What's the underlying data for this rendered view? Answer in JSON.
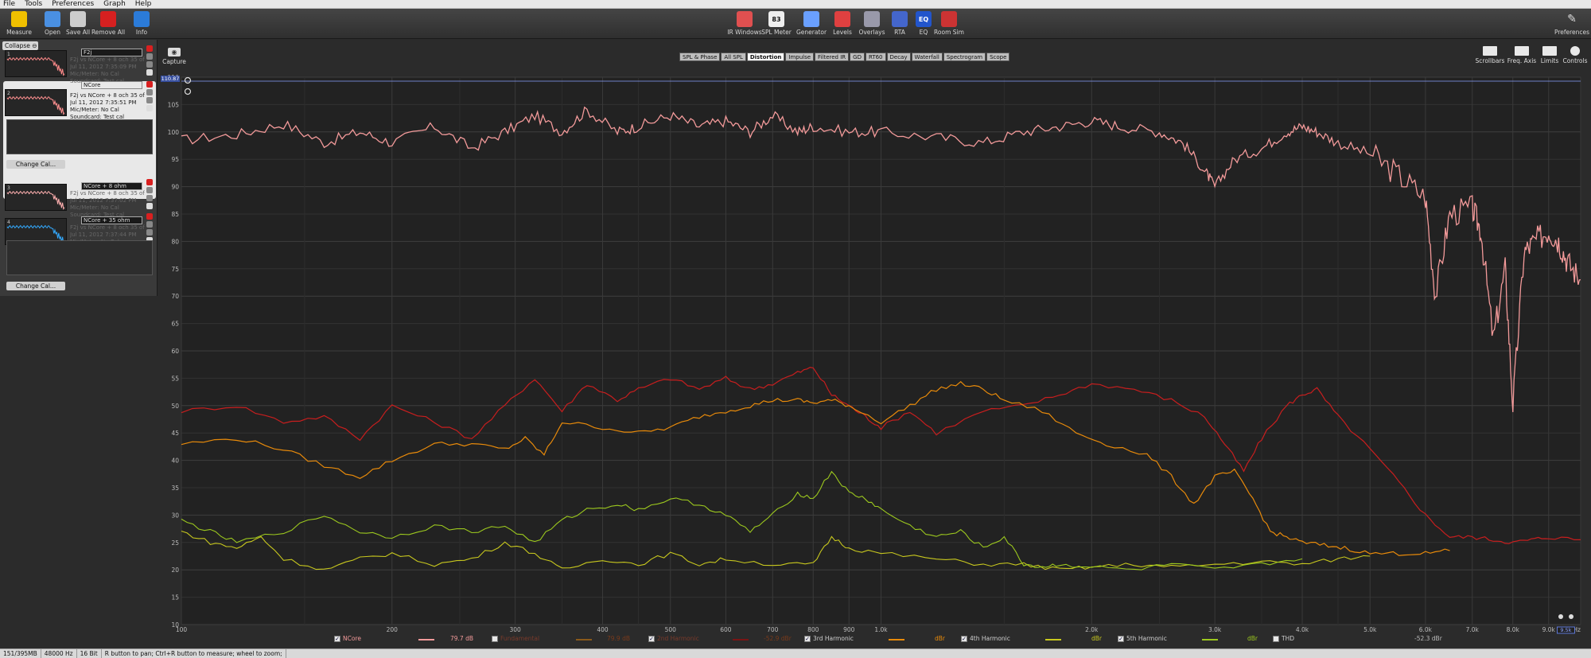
{
  "menu": [
    "File",
    "Tools",
    "Preferences",
    "Graph",
    "Help"
  ],
  "toolbar_left": [
    {
      "label": "Measure",
      "icon": "measure-icon",
      "color": "#f0c000"
    },
    {
      "label": "Open",
      "icon": "folder-icon",
      "color": "#4a90e2"
    },
    {
      "label": "Save All",
      "icon": "save-icon",
      "color": "#cccccc"
    },
    {
      "label": "Remove All",
      "icon": "remove-icon",
      "color": "#d62020"
    },
    {
      "label": "Info",
      "icon": "info-icon",
      "color": "#2b7bd9"
    }
  ],
  "toolbar_center": [
    {
      "label": "IR Windows",
      "icon": "ir-windows-icon",
      "color": "#e05050"
    },
    {
      "label": "SPL Meter",
      "icon": "spl-meter-icon",
      "color": "#eeeeee",
      "glyph": "83"
    },
    {
      "label": "Generator",
      "icon": "generator-icon",
      "color": "#6aa0ff"
    },
    {
      "label": "Levels",
      "icon": "levels-icon",
      "color": "#e04040"
    },
    {
      "label": "Overlays",
      "icon": "overlays-icon",
      "color": "#9999aa"
    },
    {
      "label": "RTA",
      "icon": "rta-icon",
      "color": "#4466cc"
    },
    {
      "label": "EQ",
      "icon": "eq-icon",
      "color": "#2255cc",
      "glyph": "EQ"
    },
    {
      "label": "Room Sim",
      "icon": "room-sim-icon",
      "color": "#cc3333"
    }
  ],
  "preferences_label": "Preferences",
  "collapse_label": "Collapse",
  "measurements": [
    {
      "name": "F2j",
      "info": [
        "F2j vs NCore + 8 och 35 of",
        "Jul 11, 2012 7:35:09 PM",
        "Mic/Meter: No Cal",
        "Soundcard: Test cal"
      ],
      "num": "1",
      "color": "#ff8a8a",
      "selected": false
    },
    {
      "name": "NCore",
      "info": [
        "F2j vs NCore + 8 och 35 of",
        "Jul 11, 2012 7:35:51 PM",
        "Mic/Meter: No Cal",
        "Soundcard: Test cal"
      ],
      "num": "2",
      "color": "#ff9090",
      "selected": true
    },
    {
      "name": "NCore + 8 ohm",
      "info": [
        "F2j vs NCore + 8 och 35 of",
        "Jul 11, 2012 7:37:02 PM",
        "Mic/Meter: No Cal",
        "Soundcard: Test cal"
      ],
      "num": "3",
      "color": "#ffb0b0",
      "selected": false
    },
    {
      "name": "NCore + 35 ohm",
      "info": [
        "F2j vs NCore + 8 och 35 of",
        "Jul 11, 2012 7:37:44 PM",
        "Mic/Meter: No Cal",
        "Soundcard: Test cal"
      ],
      "num": "4",
      "color": "#33aaff",
      "selected": false
    }
  ],
  "change_cal_label": "Change Cal...",
  "capture_label": "Capture",
  "tabs": [
    "SPL & Phase",
    "All SPL",
    "Distortion",
    "Impulse",
    "Filtered IR",
    "GD",
    "RT60",
    "Decay",
    "Waterfall",
    "Spectrogram",
    "Scope"
  ],
  "active_tab": "Distortion",
  "right_buttons": [
    "Scrollbars",
    "Freq. Axis",
    "Limits",
    "Controls"
  ],
  "top_readout": "110.87",
  "chart_data": {
    "type": "line",
    "x_scale": "log",
    "xlim": [
      100,
      10000
    ],
    "ylim": [
      10,
      110
    ],
    "y_ticks": [
      10,
      15,
      20,
      25,
      30,
      35,
      40,
      45,
      50,
      55,
      60,
      65,
      70,
      75,
      80,
      85,
      90,
      95,
      100,
      105,
      110
    ],
    "y_tick_labels": [
      "10",
      "15",
      "20",
      "25",
      "30",
      "35",
      "40",
      "45",
      "50",
      "55",
      "60",
      "65",
      "70",
      "75",
      "80",
      "85",
      "90",
      "95",
      "100",
      "105",
      "110"
    ],
    "x_ticks": [
      100,
      200,
      300,
      400,
      500,
      600,
      700,
      800,
      900,
      1000,
      2000,
      3000,
      4000,
      5000,
      6000,
      7000,
      8000,
      9000,
      10000
    ],
    "x_tick_labels": [
      "100",
      "200",
      "300",
      "400",
      "500",
      "600",
      "700",
      "800",
      "900",
      "1.0k",
      "2.0k",
      "3.0k",
      "4.0k",
      "5.0k",
      "6.0k",
      "7.0k",
      "8.0k",
      "9.0k",
      "10k Hz"
    ],
    "x_readout": "9.5k",
    "grid": true,
    "series": [
      {
        "name": "NCore",
        "color": "#f39a9a",
        "width": 1.3,
        "points": [
          [
            100,
            98.5
          ],
          [
            120,
            99.5
          ],
          [
            140,
            101.5
          ],
          [
            160,
            98
          ],
          [
            180,
            100
          ],
          [
            200,
            98
          ],
          [
            230,
            101
          ],
          [
            260,
            97
          ],
          [
            290,
            100
          ],
          [
            320,
            103
          ],
          [
            350,
            100
          ],
          [
            380,
            104
          ],
          [
            420,
            100
          ],
          [
            450,
            101
          ],
          [
            500,
            103
          ],
          [
            550,
            101
          ],
          [
            600,
            102
          ],
          [
            650,
            100
          ],
          [
            700,
            103
          ],
          [
            760,
            100
          ],
          [
            800,
            101
          ],
          [
            900,
            100
          ],
          [
            1000,
            100
          ],
          [
            1200,
            99
          ],
          [
            1400,
            98
          ],
          [
            1600,
            100
          ],
          [
            1800,
            101
          ],
          [
            2000,
            102
          ],
          [
            2200,
            101
          ],
          [
            2500,
            100
          ],
          [
            2700,
            98
          ],
          [
            2900,
            93
          ],
          [
            3000,
            90
          ],
          [
            3200,
            95
          ],
          [
            3500,
            97
          ],
          [
            3800,
            100
          ],
          [
            4000,
            101
          ],
          [
            4200,
            100
          ],
          [
            4500,
            98
          ],
          [
            5000,
            96
          ],
          [
            5500,
            92
          ],
          [
            6000,
            88
          ],
          [
            6200,
            70
          ],
          [
            6500,
            85
          ],
          [
            7000,
            86
          ],
          [
            7200,
            82
          ],
          [
            7500,
            62
          ],
          [
            7800,
            75
          ],
          [
            8000,
            50
          ],
          [
            8300,
            78
          ],
          [
            8600,
            80
          ],
          [
            9000,
            82
          ],
          [
            9300,
            80
          ],
          [
            9600,
            76
          ],
          [
            10000,
            73
          ]
        ]
      },
      {
        "name": "2nd Harmonic",
        "color": "#c81e1e",
        "width": 1.2,
        "points": [
          [
            100,
            49
          ],
          [
            120,
            50
          ],
          [
            140,
            47
          ],
          [
            160,
            48
          ],
          [
            180,
            44
          ],
          [
            200,
            50
          ],
          [
            230,
            47
          ],
          [
            260,
            44
          ],
          [
            290,
            50
          ],
          [
            320,
            55
          ],
          [
            350,
            49
          ],
          [
            380,
            54
          ],
          [
            420,
            51
          ],
          [
            450,
            53
          ],
          [
            500,
            55
          ],
          [
            550,
            53
          ],
          [
            600,
            55
          ],
          [
            650,
            53
          ],
          [
            700,
            54
          ],
          [
            760,
            56
          ],
          [
            800,
            57
          ],
          [
            850,
            52
          ],
          [
            900,
            50
          ],
          [
            950,
            48
          ],
          [
            1000,
            46
          ],
          [
            1100,
            49
          ],
          [
            1200,
            45
          ],
          [
            1400,
            49
          ],
          [
            1600,
            50
          ],
          [
            1800,
            52
          ],
          [
            2000,
            54
          ],
          [
            2300,
            53
          ],
          [
            2600,
            51
          ],
          [
            2900,
            48
          ],
          [
            3100,
            43
          ],
          [
            3300,
            38
          ],
          [
            3500,
            44
          ],
          [
            3800,
            50
          ],
          [
            4000,
            52
          ],
          [
            4200,
            53
          ],
          [
            4500,
            48
          ],
          [
            5000,
            42
          ],
          [
            5500,
            36
          ],
          [
            6000,
            30
          ],
          [
            6500,
            26
          ],
          [
            7000,
            26
          ],
          [
            7500,
            25.5
          ],
          [
            8000,
            25
          ],
          [
            8500,
            25.5
          ],
          [
            9000,
            26
          ],
          [
            10000,
            25.5
          ]
        ]
      },
      {
        "name": "3rd Harmonic",
        "color": "#e88a0a",
        "width": 1.2,
        "points": [
          [
            100,
            43
          ],
          [
            120,
            44
          ],
          [
            140,
            42
          ],
          [
            160,
            39
          ],
          [
            180,
            37
          ],
          [
            200,
            40
          ],
          [
            230,
            43
          ],
          [
            260,
            43
          ],
          [
            290,
            42
          ],
          [
            310,
            44
          ],
          [
            330,
            41
          ],
          [
            350,
            47
          ],
          [
            400,
            46
          ],
          [
            450,
            45
          ],
          [
            500,
            46
          ],
          [
            550,
            48
          ],
          [
            600,
            49
          ],
          [
            650,
            50
          ],
          [
            700,
            51
          ],
          [
            760,
            51
          ],
          [
            800,
            50.5
          ],
          [
            850,
            51
          ],
          [
            900,
            50
          ],
          [
            1000,
            47
          ],
          [
            1100,
            50
          ],
          [
            1200,
            53
          ],
          [
            1300,
            54
          ],
          [
            1400,
            53
          ],
          [
            1500,
            51
          ],
          [
            1700,
            49
          ],
          [
            1900,
            45
          ],
          [
            2100,
            43
          ],
          [
            2400,
            41
          ],
          [
            2600,
            37
          ],
          [
            2800,
            32
          ],
          [
            3000,
            37
          ],
          [
            3200,
            38
          ],
          [
            3400,
            33
          ],
          [
            3600,
            27
          ],
          [
            3800,
            26
          ],
          [
            4000,
            25
          ],
          [
            4300,
            24.5
          ],
          [
            4600,
            24
          ],
          [
            5000,
            23
          ],
          [
            5500,
            23
          ],
          [
            6000,
            23
          ],
          [
            6500,
            23.5
          ]
        ]
      },
      {
        "name": "4th Harmonic",
        "color": "#c8c81e",
        "width": 1.1,
        "points": [
          [
            100,
            27
          ],
          [
            110,
            25
          ],
          [
            120,
            24
          ],
          [
            130,
            26
          ],
          [
            140,
            22
          ],
          [
            160,
            20
          ],
          [
            180,
            22
          ],
          [
            200,
            23
          ],
          [
            230,
            21
          ],
          [
            260,
            22
          ],
          [
            290,
            25
          ],
          [
            320,
            23
          ],
          [
            350,
            20
          ],
          [
            400,
            22
          ],
          [
            450,
            21
          ],
          [
            500,
            23
          ],
          [
            550,
            21
          ],
          [
            600,
            22
          ],
          [
            700,
            21
          ],
          [
            800,
            21
          ],
          [
            850,
            26
          ],
          [
            900,
            24
          ],
          [
            1000,
            23
          ],
          [
            1200,
            22
          ],
          [
            1400,
            21
          ],
          [
            1600,
            21
          ],
          [
            1800,
            20
          ],
          [
            2000,
            20.5
          ],
          [
            2300,
            21
          ],
          [
            2600,
            20.5
          ],
          [
            3000,
            21
          ],
          [
            3500,
            21.5
          ],
          [
            4000,
            21
          ],
          [
            4500,
            22
          ],
          [
            5000,
            22.5
          ]
        ]
      },
      {
        "name": "5th Harmonic",
        "color": "#9cc81e",
        "width": 1.1,
        "points": [
          [
            100,
            29
          ],
          [
            110,
            27
          ],
          [
            120,
            25
          ],
          [
            140,
            27
          ],
          [
            160,
            30
          ],
          [
            180,
            27
          ],
          [
            200,
            26
          ],
          [
            230,
            28
          ],
          [
            260,
            27
          ],
          [
            290,
            28
          ],
          [
            320,
            25
          ],
          [
            350,
            29
          ],
          [
            380,
            31
          ],
          [
            420,
            32
          ],
          [
            450,
            31
          ],
          [
            500,
            33
          ],
          [
            550,
            32
          ],
          [
            600,
            30
          ],
          [
            650,
            27
          ],
          [
            700,
            30
          ],
          [
            760,
            34
          ],
          [
            800,
            33
          ],
          [
            850,
            38
          ],
          [
            900,
            34
          ],
          [
            950,
            33
          ],
          [
            1000,
            31
          ],
          [
            1100,
            28
          ],
          [
            1200,
            26
          ],
          [
            1300,
            27
          ],
          [
            1400,
            24
          ],
          [
            1500,
            26
          ],
          [
            1600,
            21
          ],
          [
            1700,
            20.5
          ],
          [
            1800,
            21
          ],
          [
            2000,
            20.5
          ],
          [
            2300,
            20
          ],
          [
            2600,
            21
          ],
          [
            3000,
            20
          ],
          [
            3500,
            21
          ],
          [
            4000,
            22
          ]
        ]
      }
    ]
  },
  "legend": [
    {
      "name": "NCore",
      "value": "79.7 dB",
      "color": "#f39a9a",
      "checked": true,
      "dim": false
    },
    {
      "name": "Fundamental",
      "value": "79.9 dB",
      "color": "#8a5a1a",
      "checked": false,
      "dim": true
    },
    {
      "name": "2nd Harmonic",
      "value": "-52.9 dBr",
      "color": "#7a1515",
      "checked": true,
      "dim": true
    },
    {
      "name": "3rd Harmonic",
      "value": "dBr",
      "color": "#e88a0a",
      "checked": true,
      "dim": false
    },
    {
      "name": "4th Harmonic",
      "value": "dBr",
      "color": "#c8c81e",
      "checked": true,
      "dim": false
    },
    {
      "name": "5th Harmonic",
      "value": "dBr",
      "color": "#9cc81e",
      "checked": true,
      "dim": false
    },
    {
      "name": "THD",
      "value": "-52.3 dBr",
      "color": "#aaaaaa",
      "checked": false,
      "dim": false
    }
  ],
  "status": [
    "151/395MB",
    "48000 Hz",
    "16 Bit",
    "R button to pan; Ctrl+R button to measure; wheel to zoom;"
  ]
}
